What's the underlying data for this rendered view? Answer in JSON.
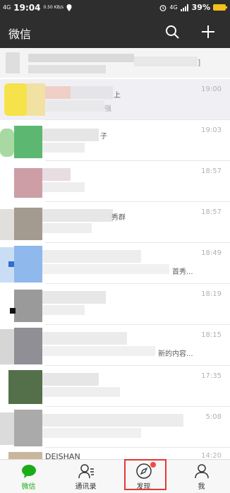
{
  "status_bar": {
    "signal": "4G",
    "time": "19:04",
    "speed": "0.50 KB/s",
    "network": "4G",
    "battery": "39%"
  },
  "header": {
    "title": "微信",
    "search_icon": "search-icon",
    "add_icon": "plus-icon"
  },
  "chats": [
    {
      "time": "19:00",
      "snippet_a": "上",
      "snippet_b": "强"
    },
    {
      "time": "19:03",
      "snippet_a": "子"
    },
    {
      "time": "18:57"
    },
    {
      "time": "18:57",
      "snippet_a": "秀群"
    },
    {
      "time": "18:49",
      "snippet_a": "首秀..."
    },
    {
      "time": "18:19"
    },
    {
      "time": "18:15",
      "snippet_a": "新的内容..."
    },
    {
      "time": "17:35"
    },
    {
      "time": "5:08"
    },
    {
      "time": "14:20",
      "snippet_a": "DEISHAN"
    }
  ],
  "tabbar": {
    "tabs": [
      {
        "label": "微信",
        "icon": "chat-bubble-icon"
      },
      {
        "label": "通讯录",
        "icon": "contacts-icon"
      },
      {
        "label": "发现",
        "icon": "compass-icon"
      },
      {
        "label": "我",
        "icon": "person-icon"
      }
    ],
    "active_color": "#1aad19",
    "badge_color": "#f04a47",
    "highlight_color": "#e53935"
  }
}
